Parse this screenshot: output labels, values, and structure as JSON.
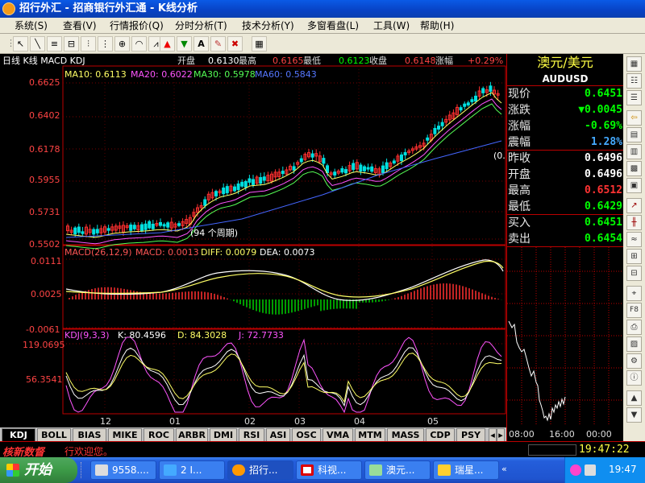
{
  "window": {
    "title": "招行外汇 - 招商银行外汇通 - K线分析"
  },
  "menu": [
    "系统(S)",
    "查看(V)",
    "行情报价(Q)",
    "分时分析(T)",
    "技术分析(Y)",
    "多窗看盘(L)",
    "工具(W)",
    "帮助(H)"
  ],
  "chart_header": {
    "label": "日线 K线 MACD KDJ",
    "items": [
      {
        "k": "开盘",
        "v": "0.6130"
      },
      {
        "k": "最高",
        "v": "0.6165"
      },
      {
        "k": "最低",
        "v": "0.6123"
      },
      {
        "k": "收盘",
        "v": "0.6148"
      },
      {
        "k": "涨幅",
        "v": "+0.29%"
      }
    ]
  },
  "ma_legend": [
    {
      "label": "MA10: 0.6113",
      "color": "#ffff66"
    },
    {
      "label": "MA20: 0.6022",
      "color": "#ff55ff"
    },
    {
      "label": "MA30: 0.5978",
      "color": "#55ff55"
    },
    {
      "label": "MA60: 0.5843",
      "color": "#5577ff"
    }
  ],
  "price_axis": [
    "0.6625",
    "0.6402",
    "0.6178",
    "0.5955",
    "0.5731",
    "0.5502"
  ],
  "period_note": "(94 个周期)",
  "truncated_label": "(0.",
  "macd": {
    "header": "MACD(26,12,9)",
    "macd": "MACD: 0.0013",
    "diff": "DIFF: 0.0079",
    "dea": "DEA: 0.0073",
    "axis": [
      "0.0111",
      "0.0025",
      "-0.0061"
    ]
  },
  "kdj": {
    "header": "KDJ(9,3,3)",
    "k": "K: 80.4596",
    "d": "D: 84.3028",
    "j": "J: 72.7733",
    "axis": [
      "119.0695",
      "56.3541"
    ]
  },
  "date_axis": [
    "12",
    "01",
    "02",
    "03",
    "04",
    "05"
  ],
  "indicator_tabs": [
    "KDJ",
    "BOLL",
    "BIAS",
    "MIKE",
    "ROC",
    "ARBR",
    "DMI",
    "RSI",
    "ASI",
    "OSC",
    "VMA",
    "MTM",
    "MASS",
    "CDP",
    "PSY"
  ],
  "quote": {
    "title": "澳元/美元",
    "symbol": "AUDUSD",
    "rows": [
      {
        "k": "现价",
        "v": "0.6451",
        "c": "#00ff00"
      },
      {
        "k": "涨跌",
        "v": "▼0.0045",
        "c": "#00ff00"
      },
      {
        "k": "涨幅",
        "v": "-0.69%",
        "c": "#00ff00"
      },
      {
        "k": "震幅",
        "v": "1.28%",
        "c": "#44aaff"
      },
      {
        "k": "昨收",
        "v": "0.6496",
        "c": "#ffffff"
      },
      {
        "k": "开盘",
        "v": "0.6496",
        "c": "#ffffff"
      },
      {
        "k": "最高",
        "v": "0.6512",
        "c": "#ff3333"
      },
      {
        "k": "最低",
        "v": "0.6429",
        "c": "#00ff00"
      },
      {
        "k": "买入",
        "v": "0.6451",
        "c": "#00ff00"
      },
      {
        "k": "卖出",
        "v": "0.6454",
        "c": "#00ff00"
      }
    ],
    "time_axis": [
      "08:00",
      "16:00",
      "00:00"
    ]
  },
  "status": {
    "news_label": "核新数督",
    "ticker": "行欢迎您。",
    "clock": "19:47:22"
  },
  "taskbar": {
    "start": "开始",
    "tasks": [
      "9558....",
      "2 I...",
      "招行...",
      "科视...",
      "澳元...",
      "瑞星..."
    ],
    "time": "19:47"
  }
}
